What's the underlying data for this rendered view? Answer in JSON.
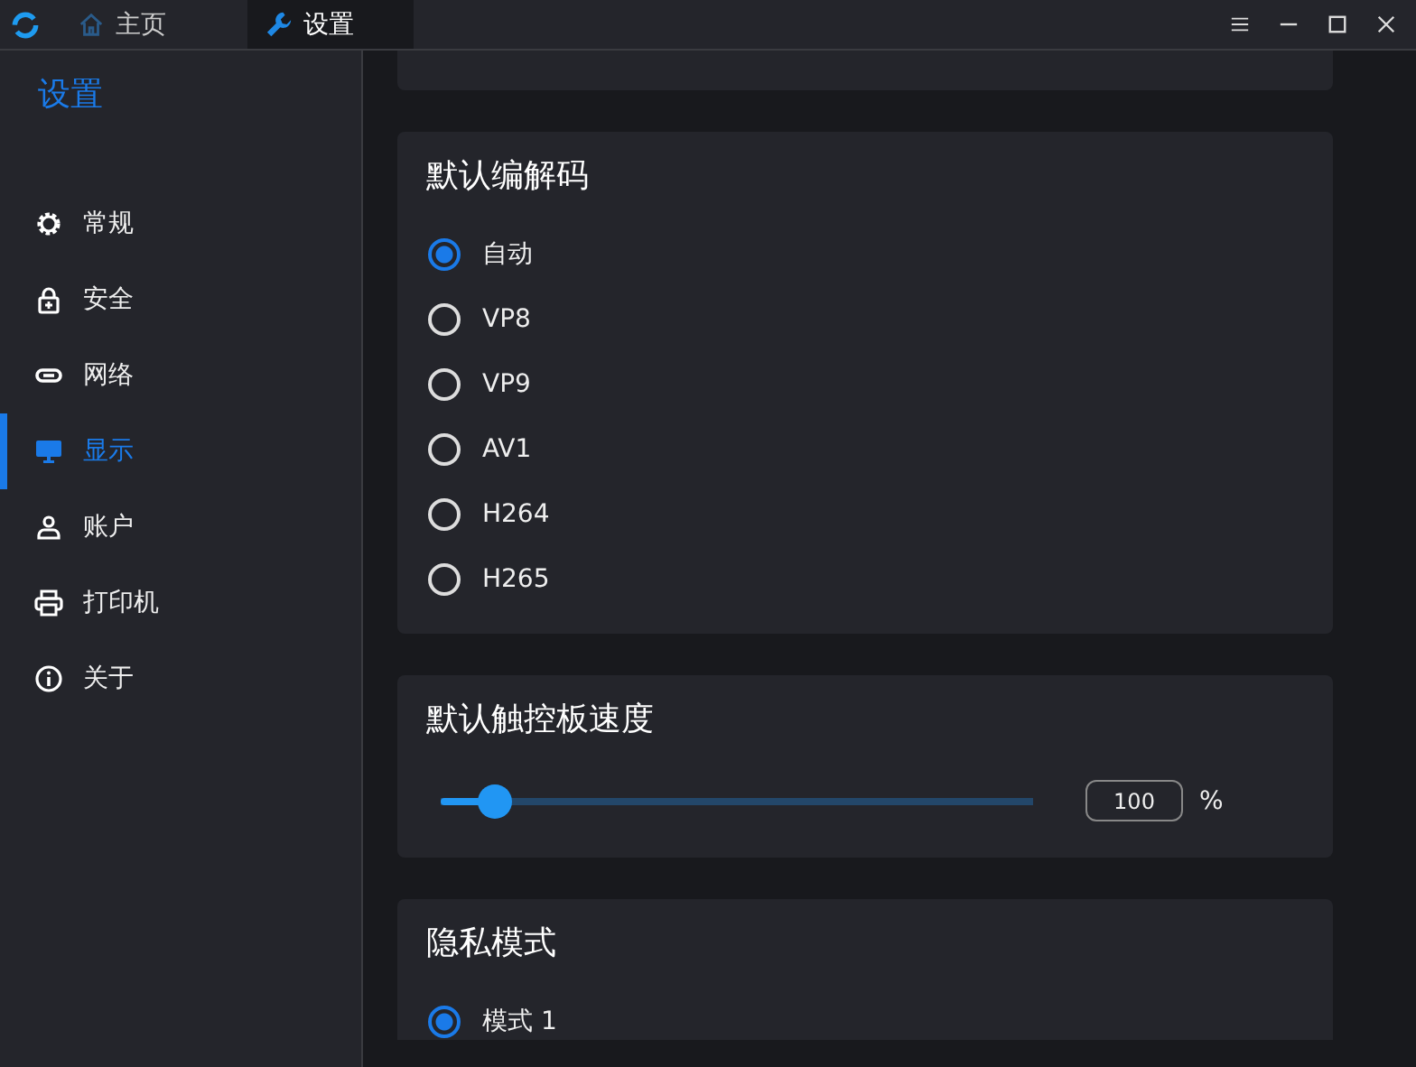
{
  "tabs": [
    {
      "label": "主页",
      "selected": false
    },
    {
      "label": "设置",
      "selected": true
    }
  ],
  "sidebar": {
    "title": "设置",
    "items": [
      {
        "label": "常规",
        "selected": false
      },
      {
        "label": "安全",
        "selected": false
      },
      {
        "label": "网络",
        "selected": false
      },
      {
        "label": "显示",
        "selected": true
      },
      {
        "label": "账户",
        "selected": false
      },
      {
        "label": "打印机",
        "selected": false
      },
      {
        "label": "关于",
        "selected": false
      }
    ]
  },
  "sections": [
    {
      "kind": "radio",
      "title": "默认编解码",
      "options": [
        {
          "label": "自动",
          "selected": true
        },
        {
          "label": "VP8",
          "selected": false
        },
        {
          "label": "VP9",
          "selected": false
        },
        {
          "label": "AV1",
          "selected": false
        },
        {
          "label": "H264",
          "selected": false
        },
        {
          "label": "H265",
          "selected": false
        }
      ]
    },
    {
      "kind": "slider",
      "title": "默认触控板速度",
      "level": 0.09,
      "value": "100",
      "unit": "%"
    },
    {
      "kind": "radio",
      "title": "隐私模式",
      "options": [
        {
          "label": "模式 1",
          "selected": true
        }
      ]
    }
  ]
}
